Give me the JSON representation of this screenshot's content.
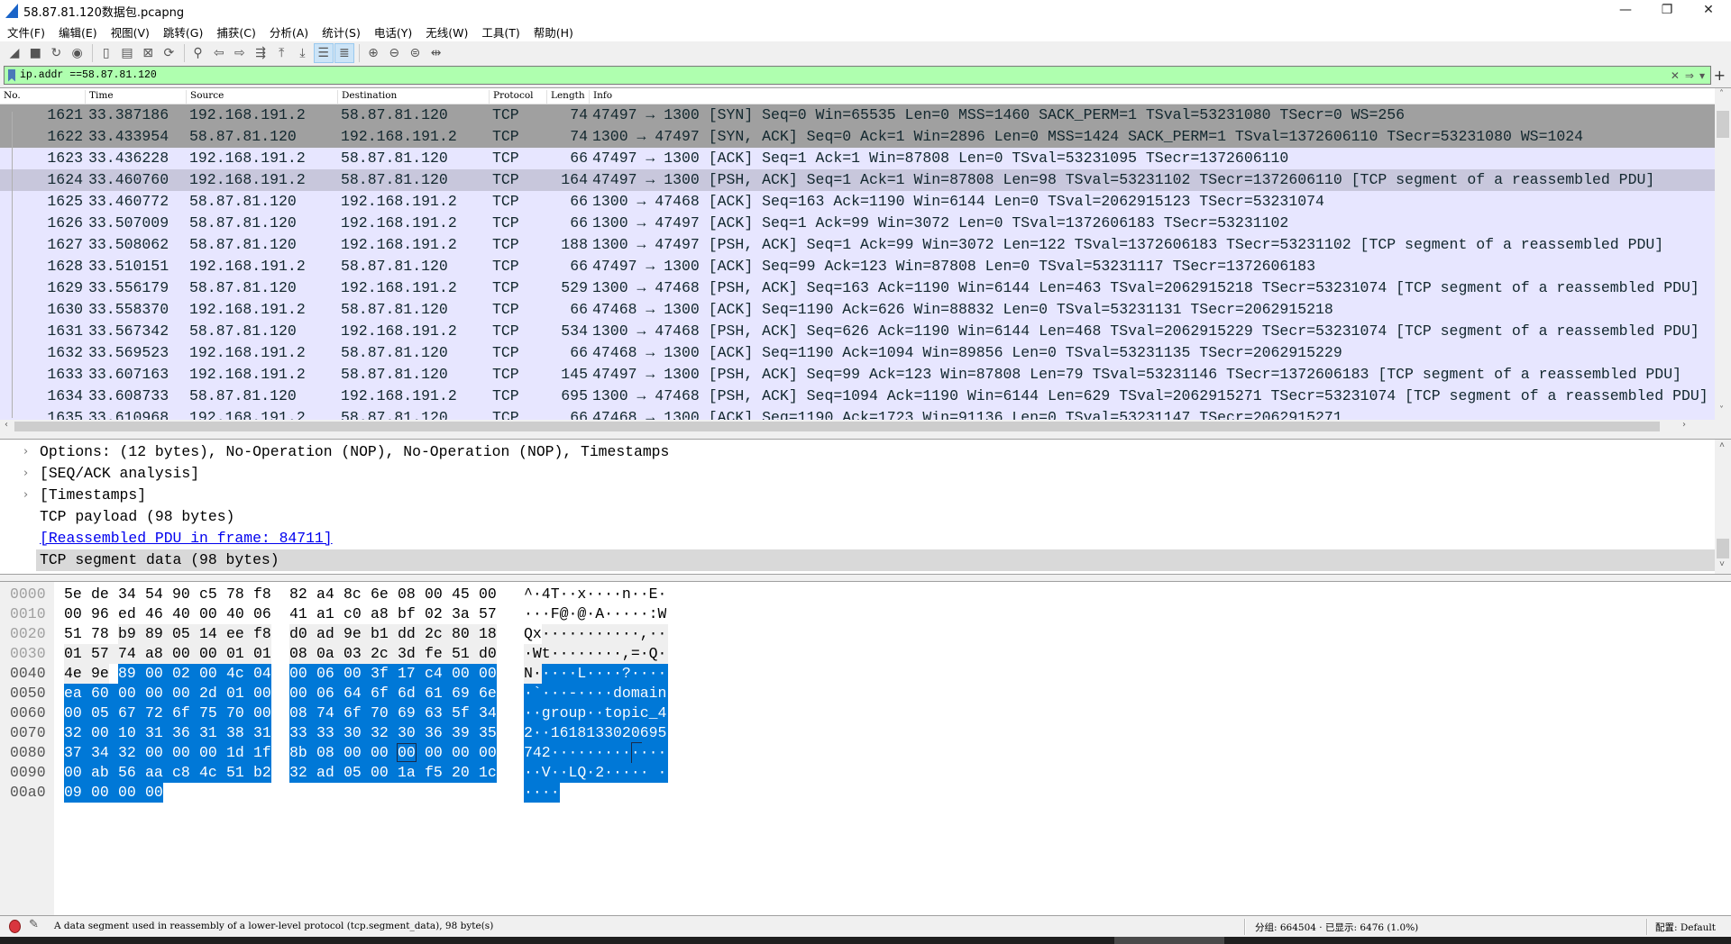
{
  "window": {
    "title": "58.87.81.120数据包.pcapng",
    "minimize": "—",
    "maximize": "❐",
    "close": "✕"
  },
  "menu": [
    "文件(F)",
    "编辑(E)",
    "视图(V)",
    "跳转(G)",
    "捕获(C)",
    "分析(A)",
    "统计(S)",
    "电话(Y)",
    "无线(W)",
    "工具(T)",
    "帮助(H)"
  ],
  "toolbar": [
    {
      "icon": "start-capture-icon",
      "glyph": "◢"
    },
    {
      "icon": "stop-capture-icon",
      "glyph": "■"
    },
    {
      "icon": "restart-capture-icon",
      "glyph": "↻"
    },
    {
      "icon": "capture-options-icon",
      "glyph": "◉"
    },
    {
      "sep": true
    },
    {
      "icon": "open-file-icon",
      "glyph": "▯"
    },
    {
      "icon": "save-file-icon",
      "glyph": "▤"
    },
    {
      "icon": "close-file-icon",
      "glyph": "⊠"
    },
    {
      "icon": "reload-file-icon",
      "glyph": "⟳"
    },
    {
      "sep": true
    },
    {
      "icon": "find-packet-icon",
      "glyph": "⚲"
    },
    {
      "icon": "go-back-icon",
      "glyph": "⇦"
    },
    {
      "icon": "go-forward-icon",
      "glyph": "⇨"
    },
    {
      "icon": "go-to-packet-icon",
      "glyph": "⇶"
    },
    {
      "icon": "first-packet-icon",
      "glyph": "⤒"
    },
    {
      "icon": "last-packet-icon",
      "glyph": "⤓"
    },
    {
      "icon": "autoscroll-icon",
      "glyph": "☰",
      "active": true
    },
    {
      "icon": "colorize-icon",
      "glyph": "≣",
      "active": true
    },
    {
      "sep": true
    },
    {
      "icon": "zoom-in-icon",
      "glyph": "⊕"
    },
    {
      "icon": "zoom-out-icon",
      "glyph": "⊖"
    },
    {
      "icon": "normal-size-icon",
      "glyph": "⊜"
    },
    {
      "icon": "resize-columns-icon",
      "glyph": "⇹"
    }
  ],
  "filter": {
    "value": "ip.addr ==58.87.81.120",
    "clear": "✕",
    "apply": "⇒",
    "dropdown": "▾",
    "add": "+"
  },
  "packet_list": {
    "columns": [
      "No.",
      "Time",
      "Source",
      "Destination",
      "Protocol",
      "Length",
      "Info"
    ],
    "rows": [
      {
        "no": "1621",
        "time": "33.387186",
        "src": "192.168.191.2",
        "dst": "58.87.81.120",
        "proto": "TCP",
        "len": "74",
        "info": "47497 → 1300 [SYN] Seq=0 Win=65535 Len=0 MSS=1460 SACK_PERM=1 TSval=53231080 TSecr=0 WS=256",
        "tag": "syn"
      },
      {
        "no": "1622",
        "time": "33.433954",
        "src": "58.87.81.120",
        "dst": "192.168.191.2",
        "proto": "TCP",
        "len": "74",
        "info": "1300 → 47497 [SYN, ACK] Seq=0 Ack=1 Win=2896 Len=0 MSS=1424 SACK_PERM=1 TSval=1372606110 TSecr=53231080 WS=1024",
        "tag": "syn"
      },
      {
        "no": "1623",
        "time": "33.436228",
        "src": "192.168.191.2",
        "dst": "58.87.81.120",
        "proto": "TCP",
        "len": "66",
        "info": "47497 → 1300 [ACK] Seq=1 Ack=1 Win=87808 Len=0 TSval=53231095 TSecr=1372606110",
        "tag": "normal"
      },
      {
        "no": "1624",
        "time": "33.460760",
        "src": "192.168.191.2",
        "dst": "58.87.81.120",
        "proto": "TCP",
        "len": "164",
        "info": "47497 → 1300 [PSH, ACK] Seq=1 Ack=1 Win=87808 Len=98 TSval=53231102 TSecr=1372606110 [TCP segment of a reassembled PDU]",
        "tag": "selected"
      },
      {
        "no": "1625",
        "time": "33.460772",
        "src": "58.87.81.120",
        "dst": "192.168.191.2",
        "proto": "TCP",
        "len": "66",
        "info": "1300 → 47468 [ACK] Seq=163 Ack=1190 Win=6144 Len=0 TSval=2062915123 TSecr=53231074",
        "tag": "normal"
      },
      {
        "no": "1626",
        "time": "33.507009",
        "src": "58.87.81.120",
        "dst": "192.168.191.2",
        "proto": "TCP",
        "len": "66",
        "info": "1300 → 47497 [ACK] Seq=1 Ack=99 Win=3072 Len=0 TSval=1372606183 TSecr=53231102",
        "tag": "normal"
      },
      {
        "no": "1627",
        "time": "33.508062",
        "src": "58.87.81.120",
        "dst": "192.168.191.2",
        "proto": "TCP",
        "len": "188",
        "info": "1300 → 47497 [PSH, ACK] Seq=1 Ack=99 Win=3072 Len=122 TSval=1372606183 TSecr=53231102 [TCP segment of a reassembled PDU]",
        "tag": "normal"
      },
      {
        "no": "1628",
        "time": "33.510151",
        "src": "192.168.191.2",
        "dst": "58.87.81.120",
        "proto": "TCP",
        "len": "66",
        "info": "47497 → 1300 [ACK] Seq=99 Ack=123 Win=87808 Len=0 TSval=53231117 TSecr=1372606183",
        "tag": "normal"
      },
      {
        "no": "1629",
        "time": "33.556179",
        "src": "58.87.81.120",
        "dst": "192.168.191.2",
        "proto": "TCP",
        "len": "529",
        "info": "1300 → 47468 [PSH, ACK] Seq=163 Ack=1190 Win=6144 Len=463 TSval=2062915218 TSecr=53231074 [TCP segment of a reassembled PDU]",
        "tag": "normal"
      },
      {
        "no": "1630",
        "time": "33.558370",
        "src": "192.168.191.2",
        "dst": "58.87.81.120",
        "proto": "TCP",
        "len": "66",
        "info": "47468 → 1300 [ACK] Seq=1190 Ack=626 Win=88832 Len=0 TSval=53231131 TSecr=2062915218",
        "tag": "normal"
      },
      {
        "no": "1631",
        "time": "33.567342",
        "src": "58.87.81.120",
        "dst": "192.168.191.2",
        "proto": "TCP",
        "len": "534",
        "info": "1300 → 47468 [PSH, ACK] Seq=626 Ack=1190 Win=6144 Len=468 TSval=2062915229 TSecr=53231074 [TCP segment of a reassembled PDU]",
        "tag": "normal"
      },
      {
        "no": "1632",
        "time": "33.569523",
        "src": "192.168.191.2",
        "dst": "58.87.81.120",
        "proto": "TCP",
        "len": "66",
        "info": "47468 → 1300 [ACK] Seq=1190 Ack=1094 Win=89856 Len=0 TSval=53231135 TSecr=2062915229",
        "tag": "normal"
      },
      {
        "no": "1633",
        "time": "33.607163",
        "src": "192.168.191.2",
        "dst": "58.87.81.120",
        "proto": "TCP",
        "len": "145",
        "info": "47497 → 1300 [PSH, ACK] Seq=99 Ack=123 Win=87808 Len=79 TSval=53231146 TSecr=1372606183 [TCP segment of a reassembled PDU]",
        "tag": "normal"
      },
      {
        "no": "1634",
        "time": "33.608733",
        "src": "58.87.81.120",
        "dst": "192.168.191.2",
        "proto": "TCP",
        "len": "695",
        "info": "1300 → 47468 [PSH, ACK] Seq=1094 Ack=1190 Win=6144 Len=629 TSval=2062915271 TSecr=53231074 [TCP segment of a reassembled PDU]",
        "tag": "normal"
      },
      {
        "no": "1635",
        "time": "33.610968",
        "src": "192.168.191.2",
        "dst": "58.87.81.120",
        "proto": "TCP",
        "len": "66",
        "info": "47468 → 1300 [ACK] Seq=1190 Ack=1723 Win=91136 Len=0 TSval=53231147 TSecr=2062915271",
        "tag": "normal"
      }
    ]
  },
  "details": [
    {
      "text": "Options: (12 bytes), No-Operation (NOP), No-Operation (NOP), Timestamps",
      "expandable": true
    },
    {
      "text": "[SEQ/ACK analysis]",
      "expandable": true
    },
    {
      "text": "[Timestamps]",
      "expandable": true
    },
    {
      "text": "TCP payload (98 bytes)",
      "expandable": false
    },
    {
      "text": "[Reassembled PDU in frame: 84711]",
      "expandable": false,
      "link": true
    },
    {
      "text": "TCP segment data (98 bytes)",
      "expandable": false,
      "selected": true
    }
  ],
  "bytes": {
    "field_range": [
      34,
      65
    ],
    "selected_range": [
      66,
      163
    ],
    "cursor_byte": 140,
    "rows": [
      {
        "offset": "0000",
        "hex": "5e de 34 54 90 c5 78 f8 82 a4 8c 6e 08 00 45 00",
        "ascii": "^·4T··x····n··E·"
      },
      {
        "offset": "0010",
        "hex": "00 96 ed 46 40 00 40 06 41 a1 c0 a8 bf 02 3a 57",
        "ascii": "···F@·@·A·····:W"
      },
      {
        "offset": "0020",
        "hex": "51 78 b9 89 05 14 ee f8 d0 ad 9e b1 dd 2c 80 18",
        "ascii": "Qx···········,··"
      },
      {
        "offset": "0030",
        "hex": "01 57 74 a8 00 00 01 01 08 0a 03 2c 3d fe 51 d0",
        "ascii": "·Wt········,=·Q·"
      },
      {
        "offset": "0040",
        "hex": "4e 9e 89 00 02 00 4c 04 00 06 00 3f 17 c4 00 00",
        "ascii": "N·····L····?····"
      },
      {
        "offset": "0050",
        "hex": "ea 60 00 00 00 2d 01 00 00 06 64 6f 6d 61 69 6e",
        "ascii": "·`···-····domain"
      },
      {
        "offset": "0060",
        "hex": "00 05 67 72 6f 75 70 00 08 74 6f 70 69 63 5f 34",
        "ascii": "··group··topic_4"
      },
      {
        "offset": "0070",
        "hex": "32 00 10 31 36 31 38 31 33 33 30 32 30 36 39 35",
        "ascii": "2··1618133020695"
      },
      {
        "offset": "0080",
        "hex": "37 34 32 00 00 00 1d 1f 8b 08 00 00 00 00 00 00",
        "ascii": "742·············"
      },
      {
        "offset": "0090",
        "hex": "00 ab 56 aa c8 4c 51 b2 32 ad 05 00 1a f5 20 1c",
        "ascii": "··V··LQ·2····· ·"
      },
      {
        "offset": "00a0",
        "hex": "09 00 00 00",
        "ascii": "····"
      }
    ]
  },
  "status": {
    "message": "A data segment used in reassembly of a lower-level protocol (tcp.segment_data), 98 byte(s)",
    "packets": "分组: 664504 · 已显示: 6476 (1.0%)",
    "profile": "配置: Default"
  },
  "colors": {
    "syn_row": "#a0a0a0",
    "tcp_row": "#e7e6ff",
    "selected_row": "#c8c7dc",
    "filter_valid": "#afffaf",
    "byte_selection": "#0078d7"
  }
}
